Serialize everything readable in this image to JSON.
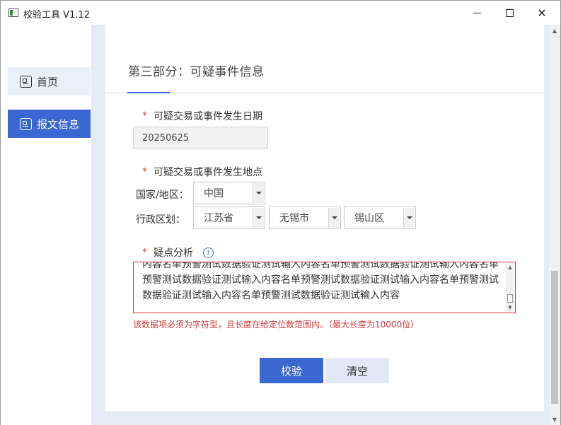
{
  "window": {
    "title": "校验工具 V1.12"
  },
  "sidebar": {
    "items": [
      {
        "label": "首页",
        "icon": "form-icon"
      },
      {
        "label": "报文信息",
        "icon": "form-icon"
      }
    ],
    "active_color": "#3a67d1"
  },
  "section": {
    "title": "第三部分：可疑事件信息"
  },
  "fields": {
    "date": {
      "label": "可疑交易或事件发生日期",
      "value": "20250625"
    },
    "location": {
      "label": "可疑交易或事件发生地点",
      "country_label": "国家/地区：",
      "country": "中国",
      "region_label": "行政区划：",
      "province": "江苏省",
      "city": "无锡市",
      "district": "锡山区"
    },
    "analysis": {
      "label": "疑点分析",
      "value": "内容名单预警测试数据验证测试输入内容名单预警测试数据验证测试输入内容名单预警测试数据验证测试输入内容名单预警测试数据验证测试输入内容名单预警测试数据验证测试输入内容名单预警测试数据验证测试输入内容",
      "error": "该数据项必须为字符型，且长度在给定位数范围内。（最大长度为10000位）"
    }
  },
  "buttons": {
    "check": "校验",
    "clear": "清空"
  },
  "colors": {
    "accent": "#3a67d1",
    "error": "#d33a3a",
    "required": "#e04848"
  }
}
